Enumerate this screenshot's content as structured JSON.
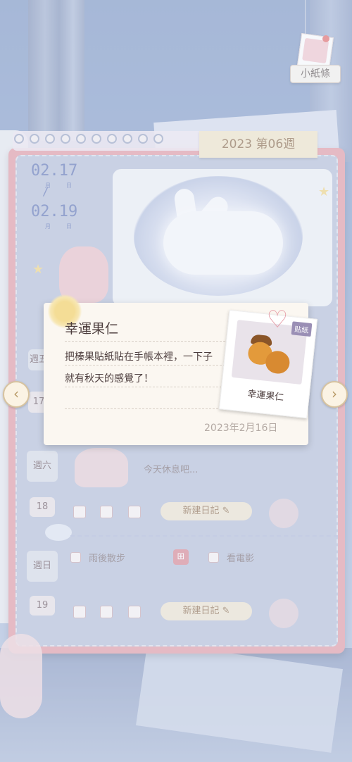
{
  "note_tab": {
    "label": "小紙條"
  },
  "week_tag": {
    "label": "2023 第06週"
  },
  "date_range": {
    "start": "02.17",
    "end": "02.19",
    "month_caption": "月",
    "day_caption": "日",
    "separator": "/"
  },
  "days": [
    {
      "weekday": "週五",
      "day": "17"
    },
    {
      "weekday": "週六",
      "day": "18",
      "text": "今天休息吧..."
    },
    {
      "weekday": "週日",
      "day": "19"
    }
  ],
  "new_diary": {
    "label": "新建日記",
    "edit_icon": "✎"
  },
  "plans": {
    "item1": "雨後散步",
    "item2": "看電影"
  },
  "popup": {
    "title": "幸運果仁",
    "description": "把榛果貼紙貼在手帳本裡，一下子就有秋天的感覺了！",
    "date": "2023年2月16日",
    "sticker": {
      "badge": "貼紙",
      "name": "幸運果仁"
    }
  },
  "nav": {
    "prev": "‹",
    "next": "›"
  },
  "colors": {
    "cover": "#e39aa5",
    "page": "#b5bfd9",
    "accent": "#5e73b5"
  }
}
